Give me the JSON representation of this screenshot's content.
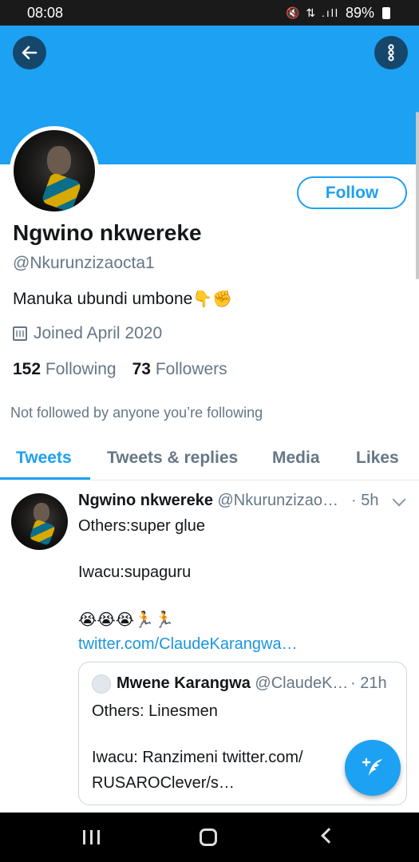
{
  "status_bar": {
    "time": "08:08",
    "icons": "🔇 ⇅ .ıll",
    "battery": "89%"
  },
  "colors": {
    "accent": "#1da1f2",
    "banner": "#1da1f2",
    "secondary_text": "#657786"
  },
  "header": {
    "back_icon": "arrow-left-icon",
    "more_icon": "vertical-dots-icon"
  },
  "profile": {
    "display_name": "Ngwino nkwereke",
    "handle": "@Nkurunzizaocta1",
    "bio_text": "Manuka ubundi umbone",
    "bio_emoji": "👇✊",
    "follow_label": "Follow",
    "joined": "Joined April 2020",
    "following_count": "152",
    "following_label": "Following",
    "followers_count": "73",
    "followers_label": "Followers",
    "not_followed_note": "Not followed by anyone you’re following"
  },
  "tabs": [
    {
      "label": "Tweets",
      "active": true
    },
    {
      "label": "Tweets & replies",
      "active": false
    },
    {
      "label": "Media",
      "active": false
    },
    {
      "label": "Likes",
      "active": false
    }
  ],
  "tweet": {
    "name": "Ngwino nkwereke",
    "handle": "@Nkurunzizao…",
    "time": "· 5h",
    "line1": "Others:super glue",
    "line2": "Iwacu:supaguru",
    "emojis": "😭😭😭🏃🏃",
    "link": "twitter.com/ClaudeKarangwa…",
    "quoted": {
      "name": "Mwene Karangwa",
      "handle": "@ClaudeK…",
      "time": "· 21h",
      "line1": "Others: Linesmen",
      "line2": "Iwacu: Ranzimeni twitter.com/",
      "line3": "RUSAROClever/s…"
    }
  },
  "fab": {
    "icon": "compose-tweet-icon"
  },
  "nav_bar": {
    "icons": [
      "recents-icon",
      "home-icon",
      "back-icon"
    ]
  }
}
